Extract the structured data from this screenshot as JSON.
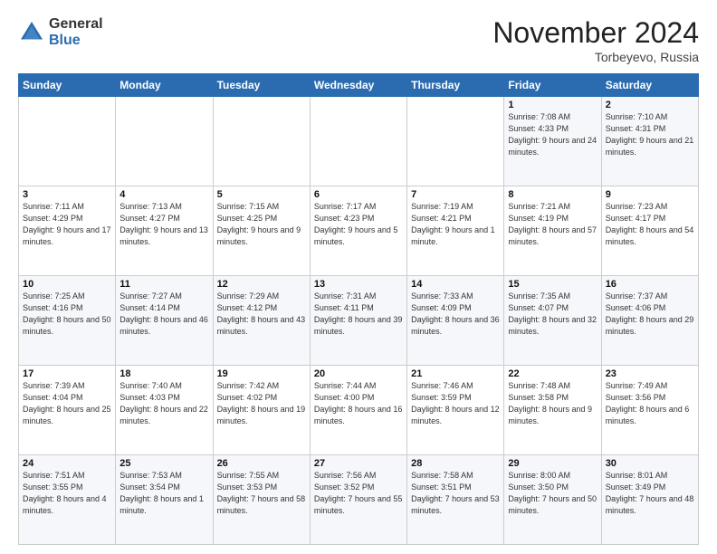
{
  "logo": {
    "general": "General",
    "blue": "Blue"
  },
  "title": "November 2024",
  "location": "Torbeyevo, Russia",
  "days_of_week": [
    "Sunday",
    "Monday",
    "Tuesday",
    "Wednesday",
    "Thursday",
    "Friday",
    "Saturday"
  ],
  "weeks": [
    [
      {
        "day": "",
        "info": ""
      },
      {
        "day": "",
        "info": ""
      },
      {
        "day": "",
        "info": ""
      },
      {
        "day": "",
        "info": ""
      },
      {
        "day": "",
        "info": ""
      },
      {
        "day": "1",
        "info": "Sunrise: 7:08 AM\nSunset: 4:33 PM\nDaylight: 9 hours and 24 minutes."
      },
      {
        "day": "2",
        "info": "Sunrise: 7:10 AM\nSunset: 4:31 PM\nDaylight: 9 hours and 21 minutes."
      }
    ],
    [
      {
        "day": "3",
        "info": "Sunrise: 7:11 AM\nSunset: 4:29 PM\nDaylight: 9 hours and 17 minutes."
      },
      {
        "day": "4",
        "info": "Sunrise: 7:13 AM\nSunset: 4:27 PM\nDaylight: 9 hours and 13 minutes."
      },
      {
        "day": "5",
        "info": "Sunrise: 7:15 AM\nSunset: 4:25 PM\nDaylight: 9 hours and 9 minutes."
      },
      {
        "day": "6",
        "info": "Sunrise: 7:17 AM\nSunset: 4:23 PM\nDaylight: 9 hours and 5 minutes."
      },
      {
        "day": "7",
        "info": "Sunrise: 7:19 AM\nSunset: 4:21 PM\nDaylight: 9 hours and 1 minute."
      },
      {
        "day": "8",
        "info": "Sunrise: 7:21 AM\nSunset: 4:19 PM\nDaylight: 8 hours and 57 minutes."
      },
      {
        "day": "9",
        "info": "Sunrise: 7:23 AM\nSunset: 4:17 PM\nDaylight: 8 hours and 54 minutes."
      }
    ],
    [
      {
        "day": "10",
        "info": "Sunrise: 7:25 AM\nSunset: 4:16 PM\nDaylight: 8 hours and 50 minutes."
      },
      {
        "day": "11",
        "info": "Sunrise: 7:27 AM\nSunset: 4:14 PM\nDaylight: 8 hours and 46 minutes."
      },
      {
        "day": "12",
        "info": "Sunrise: 7:29 AM\nSunset: 4:12 PM\nDaylight: 8 hours and 43 minutes."
      },
      {
        "day": "13",
        "info": "Sunrise: 7:31 AM\nSunset: 4:11 PM\nDaylight: 8 hours and 39 minutes."
      },
      {
        "day": "14",
        "info": "Sunrise: 7:33 AM\nSunset: 4:09 PM\nDaylight: 8 hours and 36 minutes."
      },
      {
        "day": "15",
        "info": "Sunrise: 7:35 AM\nSunset: 4:07 PM\nDaylight: 8 hours and 32 minutes."
      },
      {
        "day": "16",
        "info": "Sunrise: 7:37 AM\nSunset: 4:06 PM\nDaylight: 8 hours and 29 minutes."
      }
    ],
    [
      {
        "day": "17",
        "info": "Sunrise: 7:39 AM\nSunset: 4:04 PM\nDaylight: 8 hours and 25 minutes."
      },
      {
        "day": "18",
        "info": "Sunrise: 7:40 AM\nSunset: 4:03 PM\nDaylight: 8 hours and 22 minutes."
      },
      {
        "day": "19",
        "info": "Sunrise: 7:42 AM\nSunset: 4:02 PM\nDaylight: 8 hours and 19 minutes."
      },
      {
        "day": "20",
        "info": "Sunrise: 7:44 AM\nSunset: 4:00 PM\nDaylight: 8 hours and 16 minutes."
      },
      {
        "day": "21",
        "info": "Sunrise: 7:46 AM\nSunset: 3:59 PM\nDaylight: 8 hours and 12 minutes."
      },
      {
        "day": "22",
        "info": "Sunrise: 7:48 AM\nSunset: 3:58 PM\nDaylight: 8 hours and 9 minutes."
      },
      {
        "day": "23",
        "info": "Sunrise: 7:49 AM\nSunset: 3:56 PM\nDaylight: 8 hours and 6 minutes."
      }
    ],
    [
      {
        "day": "24",
        "info": "Sunrise: 7:51 AM\nSunset: 3:55 PM\nDaylight: 8 hours and 4 minutes."
      },
      {
        "day": "25",
        "info": "Sunrise: 7:53 AM\nSunset: 3:54 PM\nDaylight: 8 hours and 1 minute."
      },
      {
        "day": "26",
        "info": "Sunrise: 7:55 AM\nSunset: 3:53 PM\nDaylight: 7 hours and 58 minutes."
      },
      {
        "day": "27",
        "info": "Sunrise: 7:56 AM\nSunset: 3:52 PM\nDaylight: 7 hours and 55 minutes."
      },
      {
        "day": "28",
        "info": "Sunrise: 7:58 AM\nSunset: 3:51 PM\nDaylight: 7 hours and 53 minutes."
      },
      {
        "day": "29",
        "info": "Sunrise: 8:00 AM\nSunset: 3:50 PM\nDaylight: 7 hours and 50 minutes."
      },
      {
        "day": "30",
        "info": "Sunrise: 8:01 AM\nSunset: 3:49 PM\nDaylight: 7 hours and 48 minutes."
      }
    ]
  ]
}
